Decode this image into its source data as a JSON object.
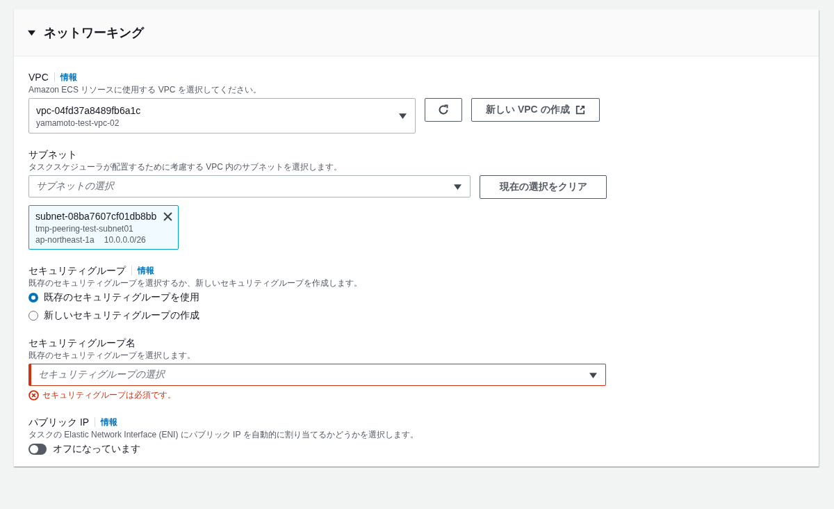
{
  "section": {
    "title": "ネットワーキング",
    "expanded": true
  },
  "vpc": {
    "label": "VPC",
    "info": "情報",
    "description": "Amazon ECS リソースに使用する VPC を選択してください。",
    "value": "vpc-04fd37a8489fb6a1c",
    "value_detail": "yamamoto-test-vpc-02",
    "new_button": "新しい VPC の作成"
  },
  "subnet": {
    "label": "サブネット",
    "description": "タスクスケジューラが配置するために考慮する VPC 内のサブネットを選択します。",
    "placeholder": "サブネットの選択",
    "clear_button": "現在の選択をクリア",
    "tokens": [
      {
        "id": "subnet-08ba7607cf01db8bb",
        "name": "tmp-peering-test-subnet01",
        "az": "ap-northeast-1a",
        "cidr": "10.0.0.0/26"
      }
    ]
  },
  "security_group": {
    "label": "セキュリティグループ",
    "info": "情報",
    "description": "既存のセキュリティグループを選択するか、新しいセキュリティグループを作成します。",
    "options": [
      {
        "label": "既存のセキュリティグループを使用",
        "selected": true
      },
      {
        "label": "新しいセキュリティグループの作成",
        "selected": false
      }
    ]
  },
  "security_group_name": {
    "label": "セキュリティグループ名",
    "description": "既存のセキュリティグループを選択します。",
    "placeholder": "セキュリティグループの選択",
    "error": "セキュリティグループは必須です。"
  },
  "public_ip": {
    "label": "パブリック IP",
    "info": "情報",
    "description": "タスクの Elastic Network Interface (ENI) にパブリック IP を自動的に割り当てるかどうかを選択します。",
    "toggle_label": "オフになっています",
    "on": false
  }
}
